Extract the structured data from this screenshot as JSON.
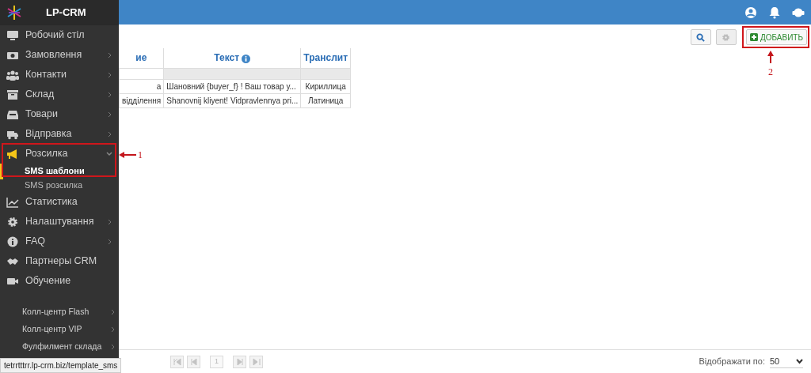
{
  "app": {
    "title": "LP-CRM"
  },
  "sidebar": {
    "sections": [
      {
        "items": [
          {
            "label": "Робочий стіл"
          },
          {
            "label": "Замовлення",
            "expanded": false
          },
          {
            "label": "Контакти",
            "expanded": false
          },
          {
            "label": "Склад",
            "expanded": false
          },
          {
            "label": "Товари",
            "expanded": false
          },
          {
            "label": "Відправка",
            "expanded": false
          },
          {
            "label": "Розсилка",
            "expanded": true,
            "annotation": "1",
            "children": [
              {
                "label": "SMS шаблони",
                "selected": true
              },
              {
                "label": "SMS розсилка",
                "selected": false
              }
            ]
          },
          {
            "label": "Статистика"
          },
          {
            "label": "Налаштування",
            "expanded": false
          },
          {
            "label": "FAQ",
            "expanded": false
          },
          {
            "label": "Партнеры CRM"
          },
          {
            "label": "Обучение"
          }
        ]
      },
      {
        "items": [
          {
            "label": "Колл-центр Flash",
            "expanded": false
          },
          {
            "label": "Колл-центр VIP",
            "expanded": false
          },
          {
            "label": "Фулфилмент склада",
            "expanded": false
          }
        ]
      }
    ]
  },
  "toolbar": {
    "buttons": [
      {
        "kind": "search",
        "disabled": false
      },
      {
        "kind": "settings",
        "disabled": true
      },
      {
        "kind": "add",
        "label": "ДОБАВИТЬ",
        "disabled": false,
        "annotation": "2"
      }
    ]
  },
  "table": {
    "columns": [
      {
        "label": "ие",
        "info": false
      },
      {
        "label": "Текст",
        "info": true
      },
      {
        "label": "Транслит",
        "info": false
      }
    ],
    "rows": [
      [
        "а",
        "Шановний {buyer_f} ! Ваш товар у...",
        "Кириллица"
      ],
      [
        "відділення",
        "Shanovnij kliyent! Vidpravlennya pri...",
        "Латиница"
      ]
    ]
  },
  "pagination": {
    "buttons": [
      {
        "kind": "first",
        "disabled": true
      },
      {
        "kind": "prev",
        "disabled": true
      },
      {
        "kind": "page",
        "label": "1",
        "disabled": true
      },
      {
        "kind": "next",
        "disabled": true
      },
      {
        "kind": "last",
        "disabled": true
      }
    ]
  },
  "page_size": {
    "label": "Відображати по:",
    "value": "50"
  },
  "status_url": "tetrrtttrr.lp-crm.biz/template_sms"
}
